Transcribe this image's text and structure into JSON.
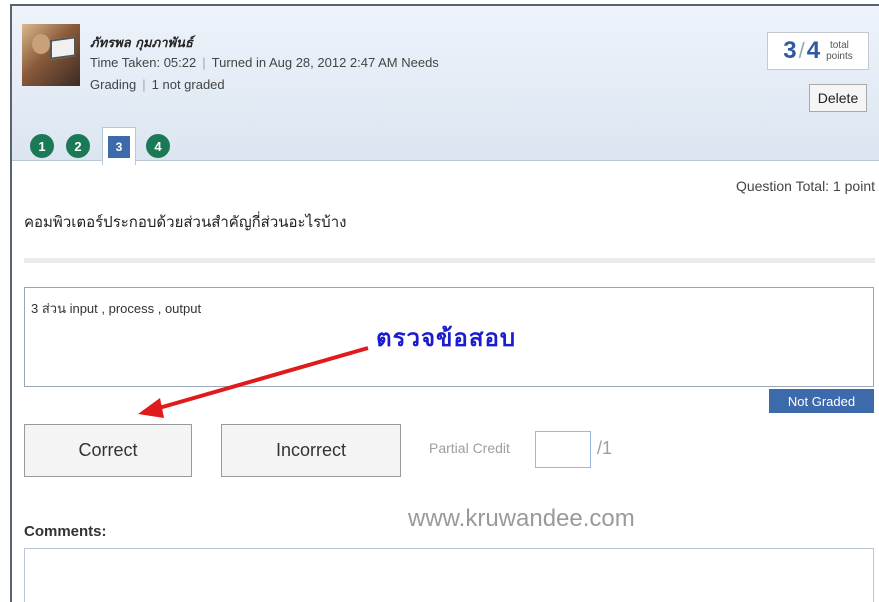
{
  "submission": {
    "student_name": "ภัทรพล กุมภาพันธ์",
    "time_taken_text": "Time Taken: 05:22",
    "turned_in_text": "Turned in Aug 28, 2012 2:47 AM Needs",
    "grading_text": "Grading",
    "not_graded_count_text": "1 not graded"
  },
  "score": {
    "earned": "3",
    "slash": "/",
    "total": "4",
    "label_line1": "total",
    "label_line2": "points"
  },
  "actions": {
    "delete_label": "Delete"
  },
  "question_nav": {
    "items": [
      "1",
      "2",
      "3",
      "4"
    ],
    "current_index": 2
  },
  "question": {
    "total_text": "Question Total: 1 point",
    "prompt": "คอมพิวเตอร์ประกอบด้วยส่วนสำคัญกี่ส่วนอะไรบ้าง",
    "answer": "3 ส่วน input , process , output"
  },
  "annotation": {
    "text": "ตรวจข้อสอบ",
    "color": "#1b1bd0",
    "arrow_color": "#e01b1b"
  },
  "grading": {
    "status": "Not Graded",
    "correct_label": "Correct",
    "incorrect_label": "Incorrect",
    "partial_label": "Partial Credit",
    "partial_value": "",
    "partial_max": "/1"
  },
  "watermark": "www.kruwandee.com",
  "comments": {
    "label": "Comments:",
    "value": ""
  },
  "colors": {
    "accent_blue": "#3d6aaa",
    "nav_green": "#1a7a55",
    "score_blue": "#2f5aa0"
  }
}
